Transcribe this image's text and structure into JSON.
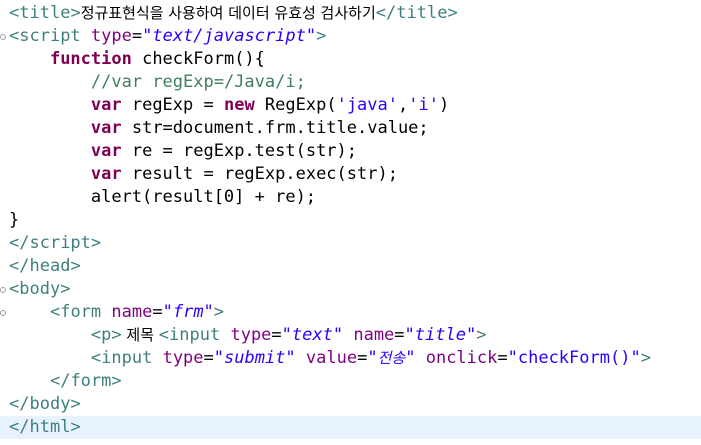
{
  "editor": {
    "lines": [
      {
        "segments": [
          {
            "t": "<",
            "c": "tag"
          },
          {
            "t": "title",
            "c": "tag"
          },
          {
            "t": ">",
            "c": "tag"
          },
          {
            "t": "정규표현식을 사용하여 데이터 유효성 검사하기",
            "c": "plain kr"
          },
          {
            "t": "</",
            "c": "tag"
          },
          {
            "t": "title",
            "c": "tag"
          },
          {
            "t": ">",
            "c": "tag"
          }
        ]
      },
      {
        "fold": true,
        "segments": [
          {
            "t": "<",
            "c": "tag"
          },
          {
            "t": "script",
            "c": "tag"
          },
          {
            "t": " ",
            "c": "plain"
          },
          {
            "t": "type",
            "c": "attr"
          },
          {
            "t": "=",
            "c": "plain"
          },
          {
            "t": "\"text/javascript\"",
            "c": "val"
          },
          {
            "t": ">",
            "c": "tag"
          }
        ]
      },
      {
        "segments": [
          {
            "t": "    ",
            "c": "plain"
          },
          {
            "t": "function",
            "c": "kw"
          },
          {
            "t": " checkForm(){",
            "c": "plain"
          }
        ]
      },
      {
        "segments": [
          {
            "t": "        ",
            "c": "plain"
          },
          {
            "t": "//var regExp=/Java/i;",
            "c": "cmt"
          }
        ]
      },
      {
        "segments": [
          {
            "t": "        ",
            "c": "plain"
          },
          {
            "t": "var",
            "c": "kw"
          },
          {
            "t": " regExp = ",
            "c": "plain"
          },
          {
            "t": "new",
            "c": "kw"
          },
          {
            "t": " RegExp(",
            "c": "plain"
          },
          {
            "t": "'java'",
            "c": "str"
          },
          {
            "t": ",",
            "c": "plain"
          },
          {
            "t": "'i'",
            "c": "str"
          },
          {
            "t": ")",
            "c": "plain"
          }
        ]
      },
      {
        "segments": [
          {
            "t": "        ",
            "c": "plain"
          },
          {
            "t": "var",
            "c": "kw"
          },
          {
            "t": " str=document.frm.title.value;",
            "c": "plain"
          }
        ]
      },
      {
        "segments": [
          {
            "t": "        ",
            "c": "plain"
          },
          {
            "t": "var",
            "c": "kw"
          },
          {
            "t": " re = regExp.test(str);",
            "c": "plain"
          }
        ]
      },
      {
        "segments": [
          {
            "t": "        ",
            "c": "plain"
          },
          {
            "t": "var",
            "c": "kw"
          },
          {
            "t": " result = regExp.exec(str);",
            "c": "plain"
          }
        ]
      },
      {
        "segments": [
          {
            "t": "        alert(result[0] + re);",
            "c": "plain"
          }
        ]
      },
      {
        "segments": [
          {
            "t": "}",
            "c": "plain"
          }
        ]
      },
      {
        "segments": [
          {
            "t": "</",
            "c": "tag"
          },
          {
            "t": "script",
            "c": "tag"
          },
          {
            "t": ">",
            "c": "tag"
          }
        ]
      },
      {
        "segments": [
          {
            "t": "</",
            "c": "tag"
          },
          {
            "t": "head",
            "c": "tag"
          },
          {
            "t": ">",
            "c": "tag"
          }
        ]
      },
      {
        "fold": true,
        "segments": [
          {
            "t": "<",
            "c": "tag"
          },
          {
            "t": "body",
            "c": "tag"
          },
          {
            "t": ">",
            "c": "tag"
          }
        ]
      },
      {
        "fold": true,
        "segments": [
          {
            "t": "    ",
            "c": "plain"
          },
          {
            "t": "<",
            "c": "tag"
          },
          {
            "t": "form",
            "c": "tag"
          },
          {
            "t": " ",
            "c": "plain"
          },
          {
            "t": "name",
            "c": "attr"
          },
          {
            "t": "=",
            "c": "plain"
          },
          {
            "t": "\"frm\"",
            "c": "val"
          },
          {
            "t": ">",
            "c": "tag"
          }
        ]
      },
      {
        "segments": [
          {
            "t": "        ",
            "c": "plain"
          },
          {
            "t": "<",
            "c": "tag"
          },
          {
            "t": "p",
            "c": "tag"
          },
          {
            "t": ">",
            "c": "tag"
          },
          {
            "t": " 제목 ",
            "c": "plain kr"
          },
          {
            "t": "<",
            "c": "tag"
          },
          {
            "t": "input",
            "c": "tag"
          },
          {
            "t": " ",
            "c": "plain"
          },
          {
            "t": "type",
            "c": "attr"
          },
          {
            "t": "=",
            "c": "plain"
          },
          {
            "t": "\"text\"",
            "c": "val"
          },
          {
            "t": " ",
            "c": "plain"
          },
          {
            "t": "name",
            "c": "attr"
          },
          {
            "t": "=",
            "c": "plain"
          },
          {
            "t": "\"title\"",
            "c": "val"
          },
          {
            "t": ">",
            "c": "tag"
          }
        ]
      },
      {
        "segments": [
          {
            "t": "        ",
            "c": "plain"
          },
          {
            "t": "<",
            "c": "tag"
          },
          {
            "t": "input",
            "c": "tag"
          },
          {
            "t": " ",
            "c": "plain"
          },
          {
            "t": "type",
            "c": "attr"
          },
          {
            "t": "=",
            "c": "plain"
          },
          {
            "t": "\"submit\"",
            "c": "val"
          },
          {
            "t": " ",
            "c": "plain"
          },
          {
            "t": "value",
            "c": "attr"
          },
          {
            "t": "=",
            "c": "plain"
          },
          {
            "t": "\"",
            "c": "val"
          },
          {
            "t": "전송",
            "c": "val kr-it"
          },
          {
            "t": "\"",
            "c": "val"
          },
          {
            "t": " ",
            "c": "plain"
          },
          {
            "t": "onclick",
            "c": "attr"
          },
          {
            "t": "=",
            "c": "plain"
          },
          {
            "t": "\"checkForm()\"",
            "c": "str"
          },
          {
            "t": ">",
            "c": "tag"
          }
        ]
      },
      {
        "segments": [
          {
            "t": "    ",
            "c": "plain"
          },
          {
            "t": "</",
            "c": "tag"
          },
          {
            "t": "form",
            "c": "tag"
          },
          {
            "t": ">",
            "c": "tag"
          }
        ]
      },
      {
        "segments": [
          {
            "t": "</",
            "c": "tag"
          },
          {
            "t": "body",
            "c": "tag"
          },
          {
            "t": ">",
            "c": "tag"
          }
        ]
      },
      {
        "current": true,
        "segments": [
          {
            "t": "</",
            "c": "tag"
          },
          {
            "t": "html",
            "c": "tag"
          },
          {
            "t": ">",
            "c": "tag"
          }
        ]
      }
    ],
    "colors": {
      "tag": "#3f7f7f",
      "attribute": "#7f007f",
      "attribute_value": "#2a00ff",
      "keyword": "#7f0055",
      "comment": "#3f7f5f",
      "current_line": "#e8f2fe"
    }
  }
}
